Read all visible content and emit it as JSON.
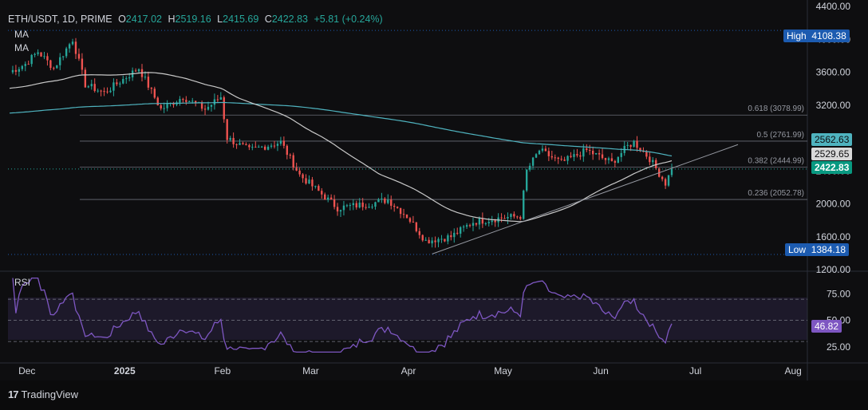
{
  "header": {
    "symbol": "ETH/USDT, 1D, PRIME",
    "o_label": "O",
    "o_value": "2417.02",
    "h_label": "H",
    "h_value": "2519.16",
    "l_label": "L",
    "l_value": "2415.69",
    "c_label": "C",
    "c_value": "2422.83",
    "change": "+5.81 (+0.24%)"
  },
  "indicators": {
    "ma1": "MA",
    "ma2": "MA",
    "rsi": "RSI"
  },
  "brand": {
    "logo": "17",
    "name": "TradingView"
  },
  "colors": {
    "bull": "#26a69a",
    "bear": "#ef5350",
    "ma_white": "#c9c9c9",
    "ma_teal": "#4fb3bf",
    "rsi": "#7e57c2",
    "price_tag": "#089981",
    "blue_tag": "#1c5bb0"
  },
  "tags": {
    "high_label": "High",
    "high_value": "4108.38",
    "low_label": "Low",
    "low_value": "1384.18",
    "ma_teal_value": "2562.63",
    "ma_white_value": "2529.65",
    "price_value": "2422.83",
    "rsi_value": "46.82",
    "rsi_hidden": "50.00"
  },
  "chart_data": [
    {
      "type": "candlestick",
      "title": "ETH/USDT, 1D, PRIME",
      "ylim": [
        1200,
        4400
      ],
      "y_ticks": [
        "4400.00",
        "4000.00",
        "3600.00",
        "3200.00",
        "2800.00",
        "2400.00",
        "2000.00",
        "1600.00",
        "1200.00"
      ],
      "x_ticks": [
        "Dec",
        "2025",
        "Feb",
        "Mar",
        "Apr",
        "May",
        "Jun",
        "Jul",
        "Aug"
      ],
      "ohlc_anchors": [
        {
          "d": "Nov 26",
          "c": 3600
        },
        {
          "d": "Dec 1",
          "c": 3700
        },
        {
          "d": "Dec 5",
          "c": 3850
        },
        {
          "d": "Dec 10",
          "c": 3650
        },
        {
          "d": "Dec 16",
          "c": 4000
        },
        {
          "d": "Dec 20",
          "c": 3450
        },
        {
          "d": "Dec 26",
          "c": 3350
        },
        {
          "d": "Jan 6",
          "c": 3650
        },
        {
          "d": "Jan 13",
          "c": 3150
        },
        {
          "d": "Jan 20",
          "c": 3300
        },
        {
          "d": "Jan 27",
          "c": 3150
        },
        {
          "d": "Feb 1",
          "c": 3300
        },
        {
          "d": "Feb 3",
          "c": 2800
        },
        {
          "d": "Feb 10",
          "c": 2650
        },
        {
          "d": "Feb 20",
          "c": 2750
        },
        {
          "d": "Feb 26",
          "c": 2350
        },
        {
          "d": "Mar 4",
          "c": 2150
        },
        {
          "d": "Mar 10",
          "c": 1950
        },
        {
          "d": "Mar 20",
          "c": 2000
        },
        {
          "d": "Mar 26",
          "c": 2050
        },
        {
          "d": "Apr 1",
          "c": 1850
        },
        {
          "d": "Apr 7",
          "c": 1550
        },
        {
          "d": "Apr 15",
          "c": 1600
        },
        {
          "d": "Apr 22",
          "c": 1780
        },
        {
          "d": "May 1",
          "c": 1830
        },
        {
          "d": "May 7",
          "c": 1850
        },
        {
          "d": "May 9",
          "c": 2400
        },
        {
          "d": "May 13",
          "c": 2650
        },
        {
          "d": "May 20",
          "c": 2500
        },
        {
          "d": "May 28",
          "c": 2650
        },
        {
          "d": "Jun 5",
          "c": 2500
        },
        {
          "d": "Jun 10",
          "c": 2700
        },
        {
          "d": "Jun 12",
          "c": 2750
        },
        {
          "d": "Jun 17",
          "c": 2550
        },
        {
          "d": "Jun 22",
          "c": 2250
        },
        {
          "d": "Jun 24",
          "c": 2420
        }
      ],
      "high": 4108.38,
      "low": 1384.18,
      "last_close": 2422.83
    },
    {
      "type": "line",
      "name": "RSI",
      "ylim": [
        15,
        95
      ],
      "y_ticks": [
        "75.00",
        "25.00"
      ],
      "bands": [
        30,
        50,
        70
      ],
      "last": 46.82
    }
  ],
  "fib_levels": [
    {
      "label": "0.618 (3078.99)",
      "value": 3078.99
    },
    {
      "label": "0.5 (2761.99)",
      "value": 2761.99
    },
    {
      "label": "0.382 (2444.99)",
      "value": 2444.99
    },
    {
      "label": "0.236 (2052.78)",
      "value": 2052.78
    }
  ]
}
